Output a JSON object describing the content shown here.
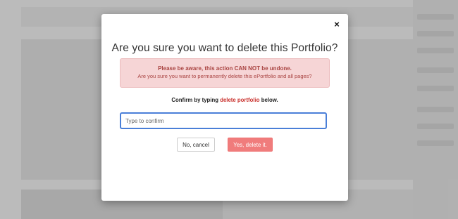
{
  "dialog": {
    "close_glyph": "×",
    "title": "Are you sure you want to delete this Portfolio?",
    "alert": {
      "strong": "Please be aware, this action CAN NOT be undone.",
      "text": "Are you sure you want to permanently delete this ePortfolio and all pages?"
    },
    "confirm": {
      "prefix": "Confirm by typing",
      "phrase": "delete portfolio",
      "suffix": "below."
    },
    "input": {
      "value": "",
      "placeholder": "Type to confirm"
    },
    "buttons": {
      "cancel": "No, cancel",
      "delete": "Yes, delete it."
    },
    "colors": {
      "alert_bg": "#f6d5d6",
      "alert_text": "#a94442",
      "phrase": "#c9302c",
      "input_focus": "#4a7fd8",
      "delete_button": "#f07c7c"
    }
  }
}
